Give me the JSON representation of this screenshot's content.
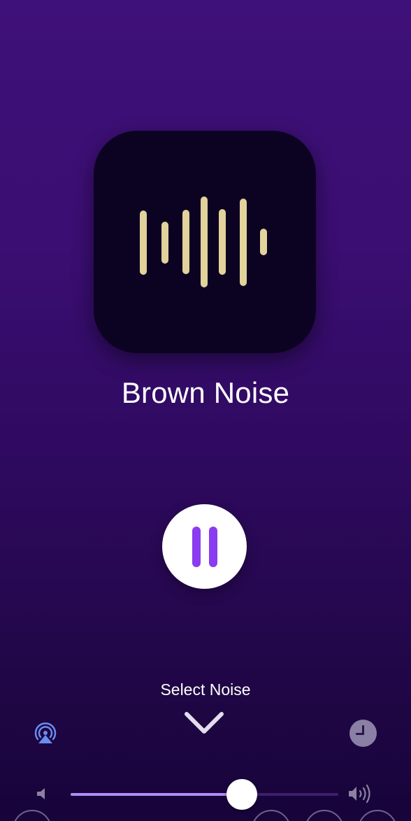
{
  "now_playing": {
    "title": "Brown Noise",
    "artwork_icon": "waveform-icon",
    "waveform_color": "#e2d29c",
    "artwork_background": "#0c0322"
  },
  "playback": {
    "state_icon": "pause-icon",
    "button_color": "#ffffff",
    "icon_color": "#8a3cf0"
  },
  "selector": {
    "label": "Select Noise",
    "icon": "chevron-down-icon"
  },
  "controls": {
    "airplay_icon": "airplay-icon",
    "timer_icon": "timer-icon"
  },
  "volume": {
    "level": 0.64,
    "min_icon": "volume-low-icon",
    "max_icon": "volume-high-icon",
    "fill_color": "#b28cf5"
  },
  "theme": {
    "background_top": "#3e1079",
    "background_bottom": "#17043a"
  }
}
